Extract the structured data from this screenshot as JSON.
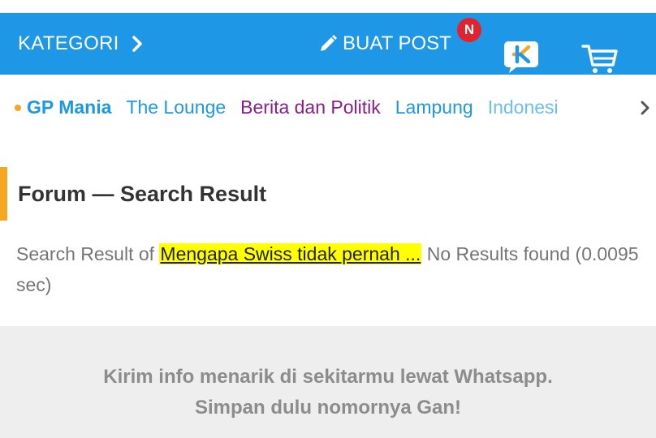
{
  "navbar": {
    "kategori_label": "KATEGORI",
    "buat_post_label": "BUAT POST",
    "notification_badge": "N",
    "bg_color": "#1e98e6",
    "icons": [
      "chevron-right-icon",
      "pencil-icon",
      "kaskus-chat-icon",
      "shopping-cart-icon"
    ]
  },
  "channels": {
    "items": [
      {
        "label": "GP Mania"
      },
      {
        "label": "The Lounge"
      },
      {
        "label": "Berita dan Politik"
      },
      {
        "label": "Lampung"
      },
      {
        "label": "Indonesi"
      }
    ]
  },
  "section": {
    "title": "Forum — Search Result",
    "accent_color": "#f5a623"
  },
  "search": {
    "prefix": "Search Result of",
    "query": "Mengapa Swiss tidak pernah ...",
    "suffix": "No Results found (0.0095 sec)",
    "highlight_color": "#ffff00"
  },
  "footer": {
    "line1": "Kirim info menarik di sekitarmu lewat Whatsapp.",
    "line2": "Simpan dulu nomornya Gan!"
  }
}
